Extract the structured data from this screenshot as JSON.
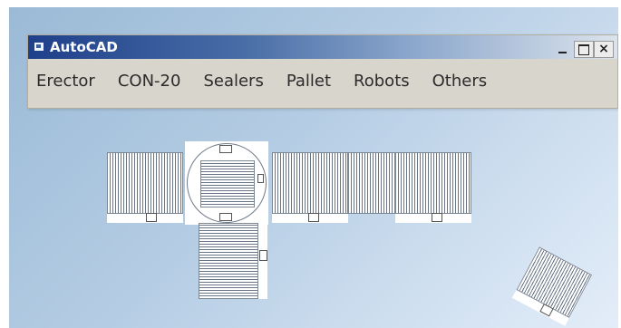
{
  "window": {
    "title": "AutoCAD",
    "controls": {
      "minimize_icon": "minimize-icon",
      "maximize_icon": "maximize-icon",
      "close_label": "×"
    }
  },
  "menu": {
    "items": [
      {
        "label": "Erector"
      },
      {
        "label": "CON-20"
      },
      {
        "label": "Sealers"
      },
      {
        "label": "Pallet"
      },
      {
        "label": "Robots"
      },
      {
        "label": "Others"
      }
    ]
  },
  "canvas": {
    "background_colors": [
      "#9bbad6",
      "#e3edf8"
    ],
    "drawing_color": "#697587",
    "blocks": [
      {
        "kind": "conveyor-roller-section"
      },
      {
        "kind": "turntable"
      },
      {
        "kind": "conveyor-roller-section"
      },
      {
        "kind": "conveyor-roller-section"
      },
      {
        "kind": "conveyor-roller-section"
      },
      {
        "kind": "conveyor-roller-section-vertical"
      },
      {
        "kind": "conveyor-roller-section-rotated"
      }
    ]
  }
}
